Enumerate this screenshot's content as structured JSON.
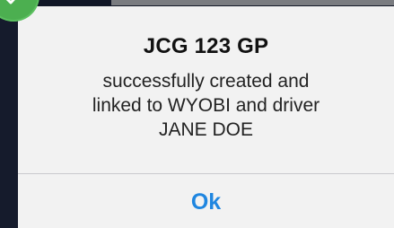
{
  "dialog": {
    "title": "JCG 123 GP",
    "message_lines": [
      "successfully created and",
      "linked to WYOBI and driver",
      "JANE DOE"
    ],
    "ok_label": "Ok"
  },
  "icons": {
    "badge": "check-icon"
  },
  "colors": {
    "accent": "#1f86e0",
    "success": "#4caf50",
    "dialog_bg": "#f2f2f2",
    "backdrop": "#111727"
  }
}
